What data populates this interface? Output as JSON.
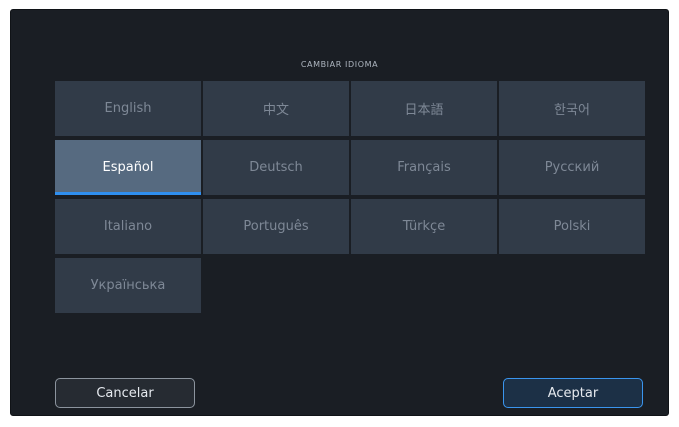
{
  "dialog": {
    "title": "CAMBIAR IDIOMA",
    "selected": "Español"
  },
  "languages": [
    {
      "label": "English"
    },
    {
      "label": "中文"
    },
    {
      "label": "日本語"
    },
    {
      "label": "한국어"
    },
    {
      "label": "Español"
    },
    {
      "label": "Deutsch"
    },
    {
      "label": "Français"
    },
    {
      "label": "Русский"
    },
    {
      "label": "Italiano"
    },
    {
      "label": "Português"
    },
    {
      "label": "Türkçe"
    },
    {
      "label": "Polski"
    },
    {
      "label": "Українська"
    }
  ],
  "buttons": {
    "cancel_label": "Cancelar",
    "accept_label": "Aceptar"
  },
  "colors": {
    "background": "#1a1e24",
    "tile": "#313b48",
    "tile_selected": "#566a80",
    "accent": "#2f8ff0"
  }
}
